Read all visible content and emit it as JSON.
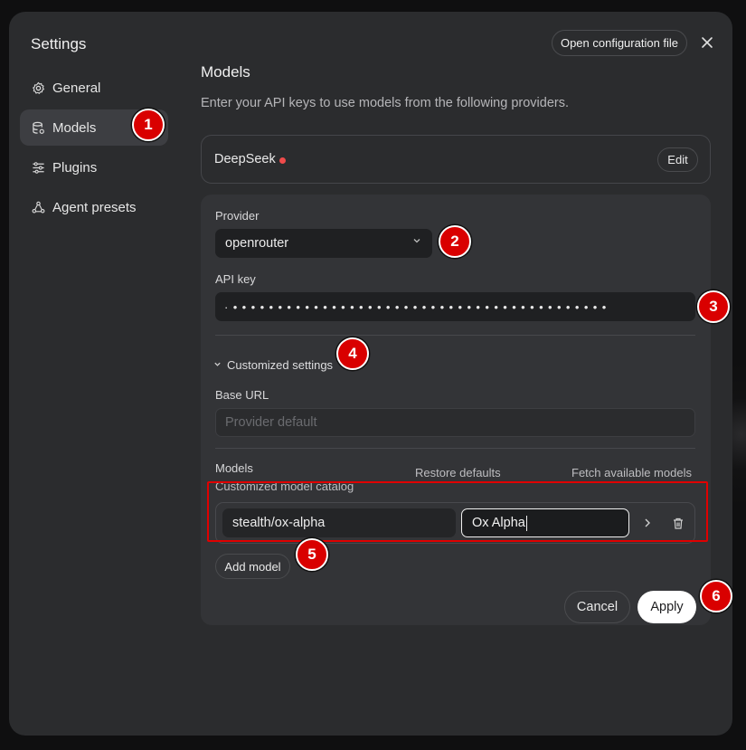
{
  "dialog": {
    "title": "Settings",
    "open_config_label": "Open configuration file",
    "close_icon": "close-icon"
  },
  "sidebar": {
    "items": [
      {
        "label": "General",
        "icon": "gear-icon",
        "active": false
      },
      {
        "label": "Models",
        "icon": "database-icon",
        "active": true
      },
      {
        "label": "Plugins",
        "icon": "sliders-icon",
        "active": false
      },
      {
        "label": "Agent presets",
        "icon": "agent-icon",
        "active": false
      }
    ]
  },
  "main": {
    "title": "Models",
    "description": "Enter your API keys to use models from the following providers.",
    "provider_card": {
      "name": "DeepSeek",
      "status_color": "#ef4b4b",
      "edit_label": "Edit"
    },
    "form": {
      "provider_label": "Provider",
      "provider_value": "openrouter",
      "api_key_label": "API key",
      "api_key_value": "·••••••••••••••••••••••••••••••••••••••••••",
      "customized_settings_label": "Customized settings",
      "base_url_label": "Base URL",
      "base_url_placeholder": "Provider default",
      "models_label": "Models",
      "models_sub_label": "Customized model catalog",
      "restore_defaults_label": "Restore defaults",
      "fetch_models_label": "Fetch available models",
      "model_rows": [
        {
          "id": "stealth/ox-alpha",
          "name": "Ox Alpha"
        }
      ],
      "add_model_label": "Add model",
      "cancel_label": "Cancel",
      "apply_label": "Apply"
    }
  },
  "annotations": {
    "badges": [
      "1",
      "2",
      "3",
      "4",
      "5",
      "6"
    ],
    "badge_color": "#d90000",
    "highlight_color": "#e00000"
  }
}
